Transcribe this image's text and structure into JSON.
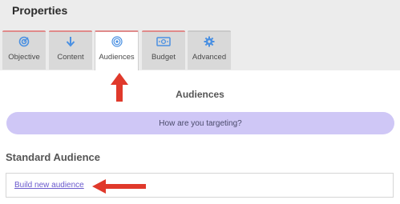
{
  "panel": {
    "title": "Properties"
  },
  "tabs": [
    {
      "label": "Objective",
      "icon": "target-icon",
      "active": false
    },
    {
      "label": "Content",
      "icon": "arrow-down-icon",
      "active": false
    },
    {
      "label": "Audiences",
      "icon": "target-rings-icon",
      "active": true
    },
    {
      "label": "Budget",
      "icon": "money-icon",
      "active": false
    },
    {
      "label": "Advanced",
      "icon": "gear-icon",
      "active": false
    }
  ],
  "audiences": {
    "heading": "Audiences",
    "targeting_prompt": "How are you targeting?",
    "standard_heading": "Standard Audience",
    "build_link": "Build new audience"
  },
  "colors": {
    "accent_blue": "#4a90e2",
    "pill_bg": "#cfc7f6",
    "arrow_red": "#e0392b",
    "link": "#6a5acd"
  }
}
